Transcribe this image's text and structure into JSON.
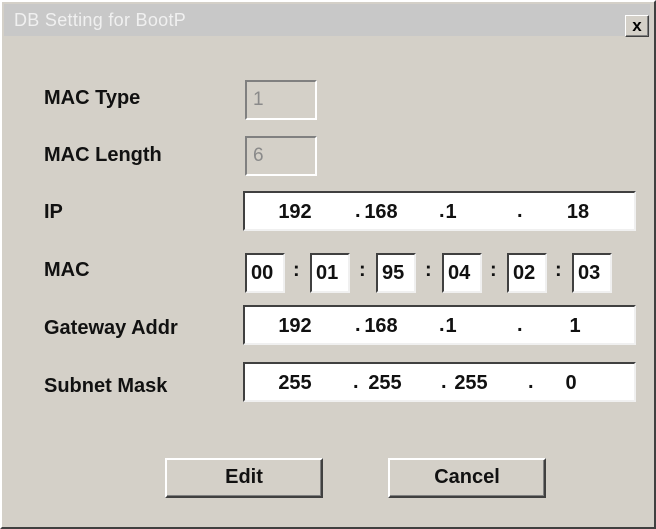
{
  "window": {
    "title": "DB Setting for BootP",
    "close_glyph": "x"
  },
  "fields": {
    "mac_type": {
      "label": "MAC Type",
      "value": "1"
    },
    "mac_length": {
      "label": "MAC Length",
      "value": "6"
    },
    "ip": {
      "label": "IP",
      "octets": [
        "192",
        "168",
        "1",
        "18"
      ]
    },
    "mac": {
      "label": "MAC",
      "bytes": [
        "00",
        "01",
        "95",
        "04",
        "02",
        "03"
      ]
    },
    "gateway": {
      "label": "Gateway Addr",
      "octets": [
        "192",
        "168",
        "1",
        "1"
      ]
    },
    "subnet": {
      "label": "Subnet Mask",
      "octets": [
        "255",
        "255",
        "255",
        "0"
      ]
    }
  },
  "separators": {
    "dot": ".",
    "colon": ":"
  },
  "buttons": {
    "edit": "Edit",
    "cancel": "Cancel"
  }
}
